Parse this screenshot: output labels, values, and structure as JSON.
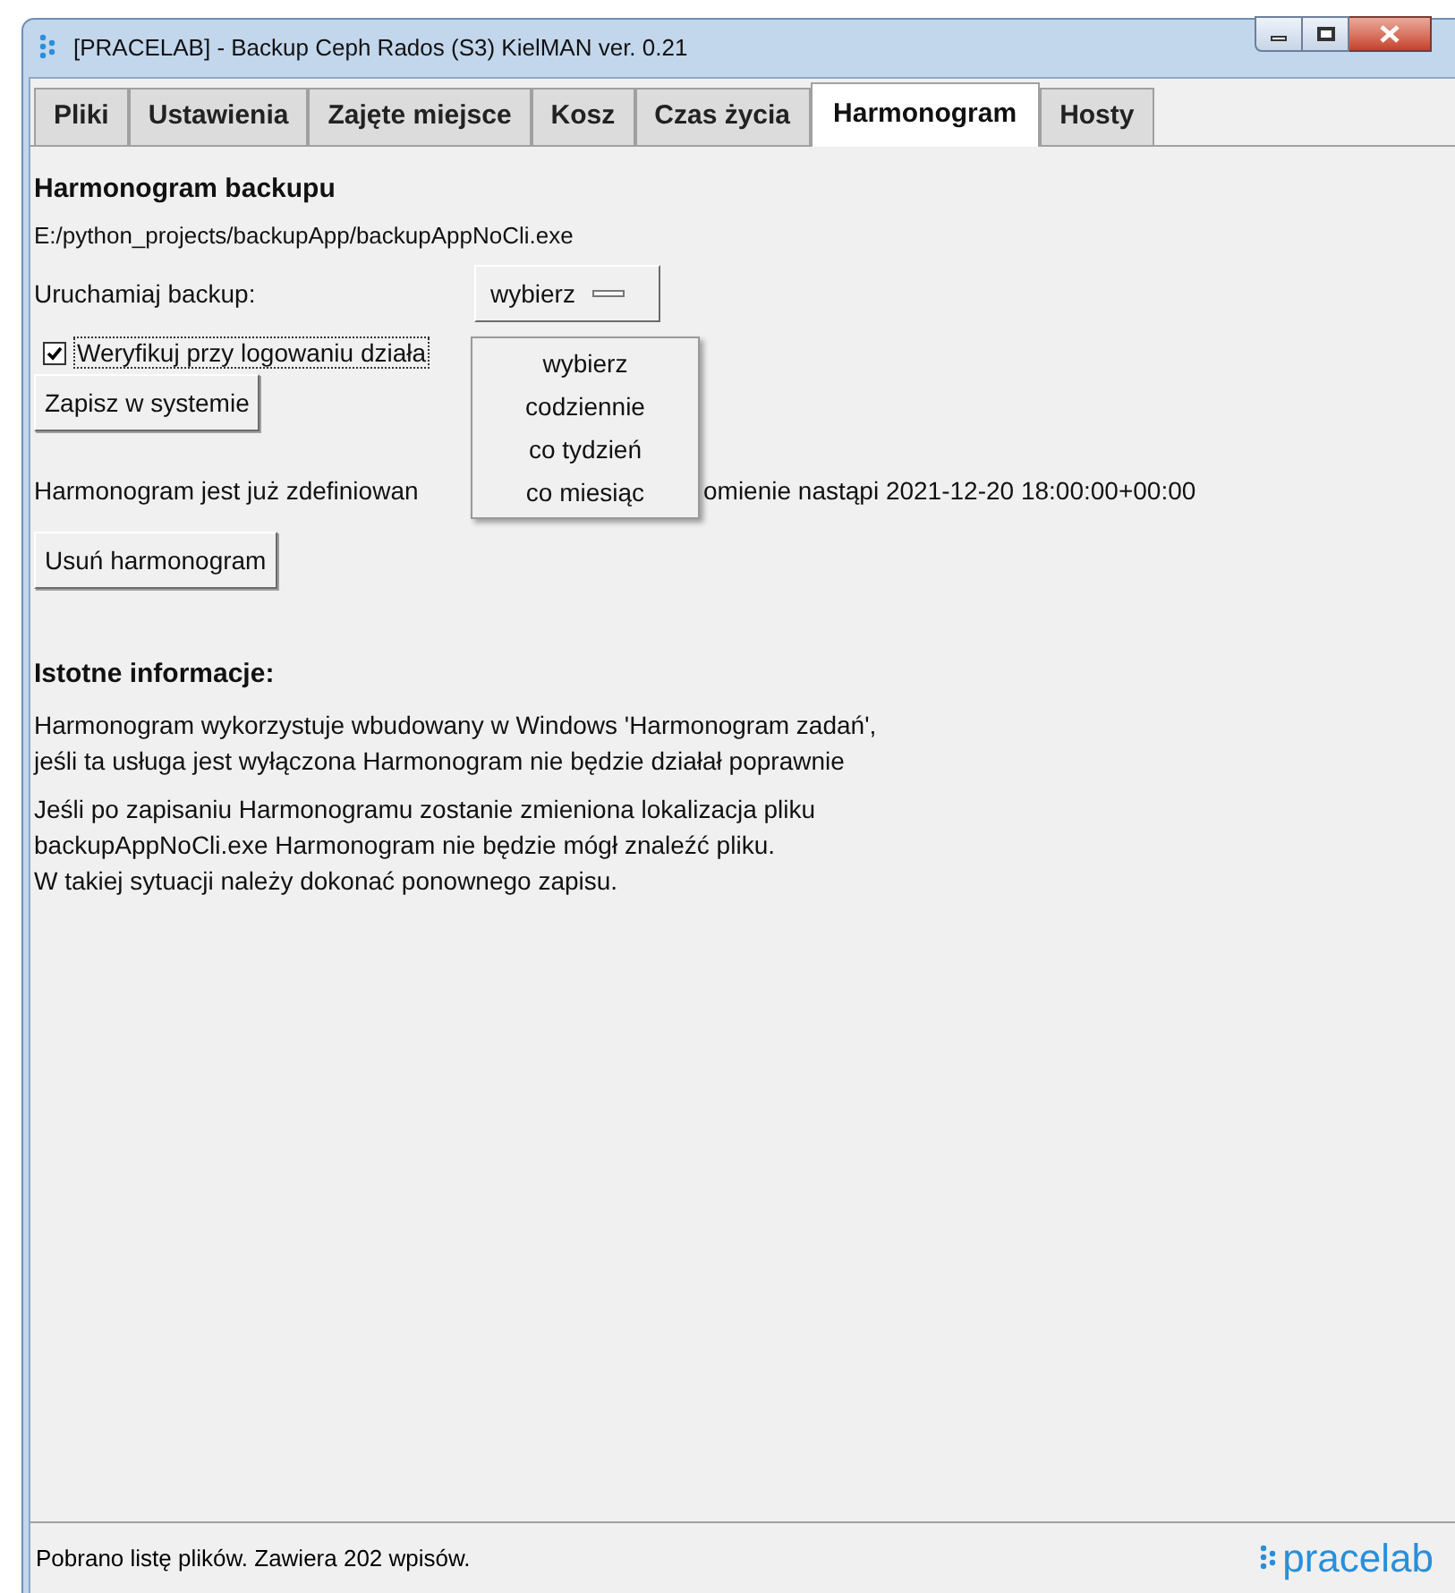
{
  "window": {
    "title": "[PRACELAB] - Backup Ceph Rados (S3) KielMAN ver. 0.21"
  },
  "tabs": [
    {
      "label": "Pliki",
      "selected": false
    },
    {
      "label": "Ustawienia",
      "selected": false
    },
    {
      "label": "Zajęte miejsce",
      "selected": false
    },
    {
      "label": "Kosz",
      "selected": false
    },
    {
      "label": "Czas życia",
      "selected": false
    },
    {
      "label": "Harmonogram",
      "selected": true
    },
    {
      "label": "Hosty",
      "selected": false
    }
  ],
  "section_title": "Harmonogram backupu",
  "exe_path": "E:/python_projects/backupApp/backupAppNoCli.exe",
  "schedule": {
    "label": "Uruchamiaj backup:",
    "value": "wybierz",
    "expanded": true,
    "options": [
      {
        "label": "wybierz"
      },
      {
        "label": "codziennie"
      },
      {
        "label": "co tydzień"
      },
      {
        "label": "co miesiąc"
      }
    ]
  },
  "verify": {
    "label": "Weryfikuj przy logowaniu działa",
    "checked": true
  },
  "save_button": "Zapisz w systemie",
  "status_line": [
    "Harmonogram jest już zdefiniowan",
    "omienie nastąpi 2021-12-20 18:00:00+00:00"
  ],
  "delete_button": "Usuń harmonogram",
  "info": {
    "title": "Istotne informacje:",
    "paragraphs": [
      [
        "Harmonogram wykorzystuje wbudowany w Windows 'Harmonogram zadań',",
        "jeśli ta usługa jest wyłączona Harmonogram nie będzie działał poprawnie"
      ],
      [
        "Jeśli po zapisaniu Harmonogramu zostanie zmieniona lokalizacja pliku",
        "backupAppNoCli.exe Harmonogram nie będzie mógł znaleźć pliku.",
        "W takiej sytuacji należy dokonać ponownego zapisu."
      ]
    ]
  },
  "status_bar": {
    "text": "Pobrano listę plików. Zawiera 202 wpisów.",
    "logo": "pracelab"
  }
}
